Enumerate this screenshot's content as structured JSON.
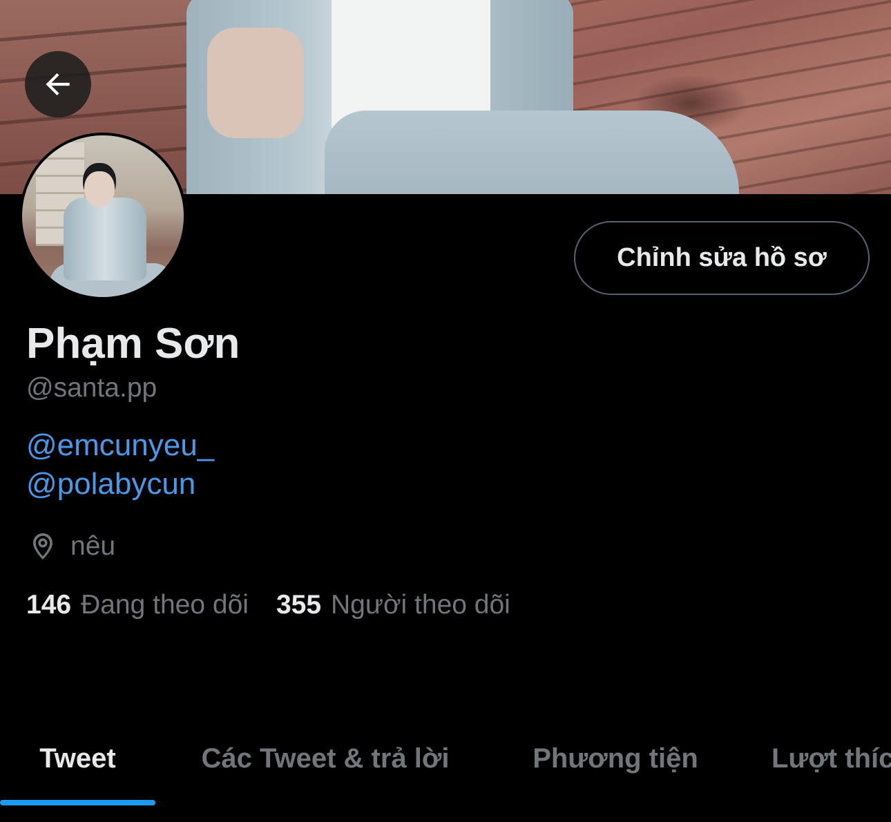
{
  "profile": {
    "display_name": "Phạm Sơn",
    "handle": "@santa.pp",
    "bio_mentions": [
      "@emcunyeu_",
      "@polabycun"
    ],
    "location": "nêu",
    "edit_profile_label": "Chỉnh sửa hồ sơ"
  },
  "stats": {
    "following_count": "146",
    "following_label": "Đang theo dõi",
    "followers_count": "355",
    "followers_label": "Người theo dõi"
  },
  "tabs": [
    {
      "label": "Tweet",
      "active": true
    },
    {
      "label": "Các Tweet & trả lời",
      "active": false
    },
    {
      "label": "Phương tiện",
      "active": false
    },
    {
      "label": "Lượt thích",
      "active": false
    }
  ],
  "icons": {
    "back": "arrow-left-icon",
    "location": "location-pin-icon"
  },
  "colors": {
    "background": "#000000",
    "primary_text": "#e7e9ea",
    "secondary_text": "#71767b",
    "link": "#4a99e9",
    "accent": "#1d9bf0",
    "button_border": "#536471"
  }
}
